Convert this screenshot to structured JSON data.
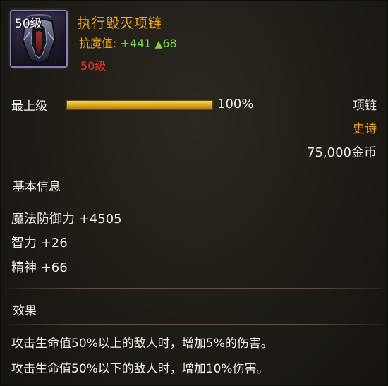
{
  "item": {
    "icon_level": "50级",
    "name": "执行毁灭项链",
    "stat_label": "抗魔值:",
    "stat_value": "+441",
    "stat_up_arrow": "▲",
    "stat_up_value": "68",
    "required_level": "50级",
    "icon": "necklace-icon"
  },
  "upgrade": {
    "label": "最上级",
    "progress_text": "100%",
    "progress": 1.0
  },
  "meta": {
    "type": "项链",
    "rarity": "史诗",
    "price": "75,000金币"
  },
  "basic_info": {
    "title": "基本信息",
    "attributes": [
      "魔法防御力 +4505",
      "智力 +26",
      "精神 +66"
    ]
  },
  "effects": {
    "title": "效果",
    "lines": [
      "攻击生命值50%以上的敌人时，增加5%的伤害。",
      "攻击生命值50%以下的敌人时，增加10%伤害。"
    ]
  },
  "colors": {
    "name": "#f2a626",
    "stat_label": "#e0a21e",
    "stat_value": "#7fd04a",
    "required_level": "#e03a32",
    "rarity": "#f2a626",
    "progress_fill": "#e2b52a"
  }
}
